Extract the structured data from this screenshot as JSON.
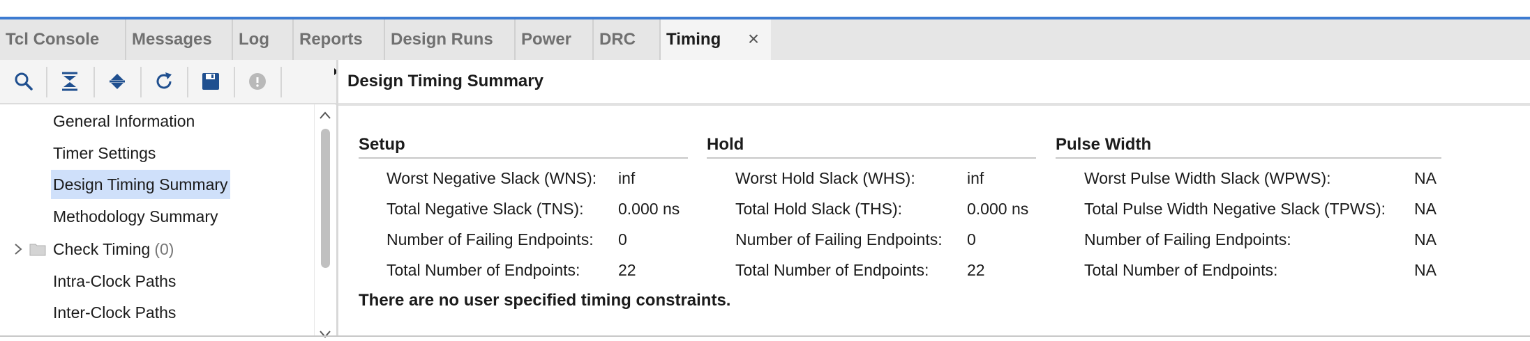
{
  "tabs": [
    {
      "label": "Tcl Console",
      "active": false
    },
    {
      "label": "Messages",
      "active": false
    },
    {
      "label": "Log",
      "active": false
    },
    {
      "label": "Reports",
      "active": false
    },
    {
      "label": "Design Runs",
      "active": false
    },
    {
      "label": "Power",
      "active": false
    },
    {
      "label": "DRC",
      "active": false
    },
    {
      "label": "Timing",
      "active": true
    }
  ],
  "close_symbol": "×",
  "toolbar": {
    "icons": [
      "search-icon",
      "collapse-all-icon",
      "expand-all-icon",
      "refresh-icon",
      "save-icon",
      "stop-icon"
    ]
  },
  "tree": {
    "items": [
      {
        "label": "General Information",
        "count": "",
        "selected": false
      },
      {
        "label": "Timer Settings",
        "count": "",
        "selected": false
      },
      {
        "label": "Design Timing Summary",
        "count": "",
        "selected": true
      },
      {
        "label": "Methodology Summary",
        "count": "",
        "selected": false
      },
      {
        "label": "Check Timing",
        "count": "(0)",
        "selected": false
      },
      {
        "label": "Intra-Clock Paths",
        "count": "",
        "selected": false
      },
      {
        "label": "Inter-Clock Paths",
        "count": "",
        "selected": false
      }
    ]
  },
  "main": {
    "title": "Design Timing Summary",
    "sections": [
      {
        "title": "Setup",
        "rows": [
          {
            "label": "Worst Negative Slack (WNS):",
            "value": "inf"
          },
          {
            "label": "Total Negative Slack (TNS):",
            "value": "0.000 ns"
          },
          {
            "label": "Number of Failing Endpoints:",
            "value": "0"
          },
          {
            "label": "Total Number of Endpoints:",
            "value": "22"
          }
        ]
      },
      {
        "title": "Hold",
        "rows": [
          {
            "label": "Worst Hold Slack (WHS):",
            "value": "inf"
          },
          {
            "label": "Total Hold Slack (THS):",
            "value": "0.000 ns"
          },
          {
            "label": "Number of Failing Endpoints:",
            "value": "0"
          },
          {
            "label": "Total Number of Endpoints:",
            "value": "22"
          }
        ]
      },
      {
        "title": "Pulse Width",
        "rows": [
          {
            "label": "Worst Pulse Width Slack (WPWS):",
            "value": "NA"
          },
          {
            "label": "Total Pulse Width Negative Slack (TPWS):",
            "value": "NA"
          },
          {
            "label": "Number of Failing Endpoints:",
            "value": "NA"
          },
          {
            "label": "Total Number of Endpoints:",
            "value": "NA"
          }
        ]
      }
    ],
    "note": "There are no user specified timing constraints."
  },
  "colors": {
    "accent": "#3d7bd1",
    "selection": "#cfe0fa",
    "toolbar_icon": "#1f4f8f"
  }
}
